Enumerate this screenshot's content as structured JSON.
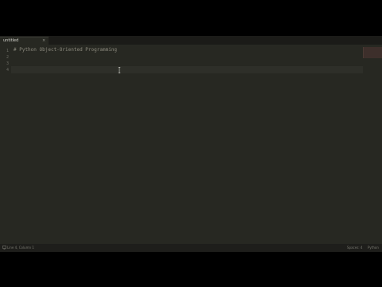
{
  "tab": {
    "title": "untitled",
    "close_glyph": "×"
  },
  "editor": {
    "lines": [
      {
        "number": "1",
        "text": "# Python Object-Oriented Programming"
      },
      {
        "number": "2",
        "text": ""
      },
      {
        "number": "3",
        "text": ""
      },
      {
        "number": "4",
        "text": ""
      }
    ],
    "current_line": 4
  },
  "statusbar": {
    "icon": "monitor-icon",
    "left_text": "Line 4, Column 1",
    "indent_text": "Spaces: 4",
    "syntax_text": "Python"
  },
  "colors": {
    "editor_bg": "#272822",
    "comment": "#8c8a7e",
    "line_number": "#6b6b63",
    "minimap_viewport": "#3d2f2b"
  }
}
